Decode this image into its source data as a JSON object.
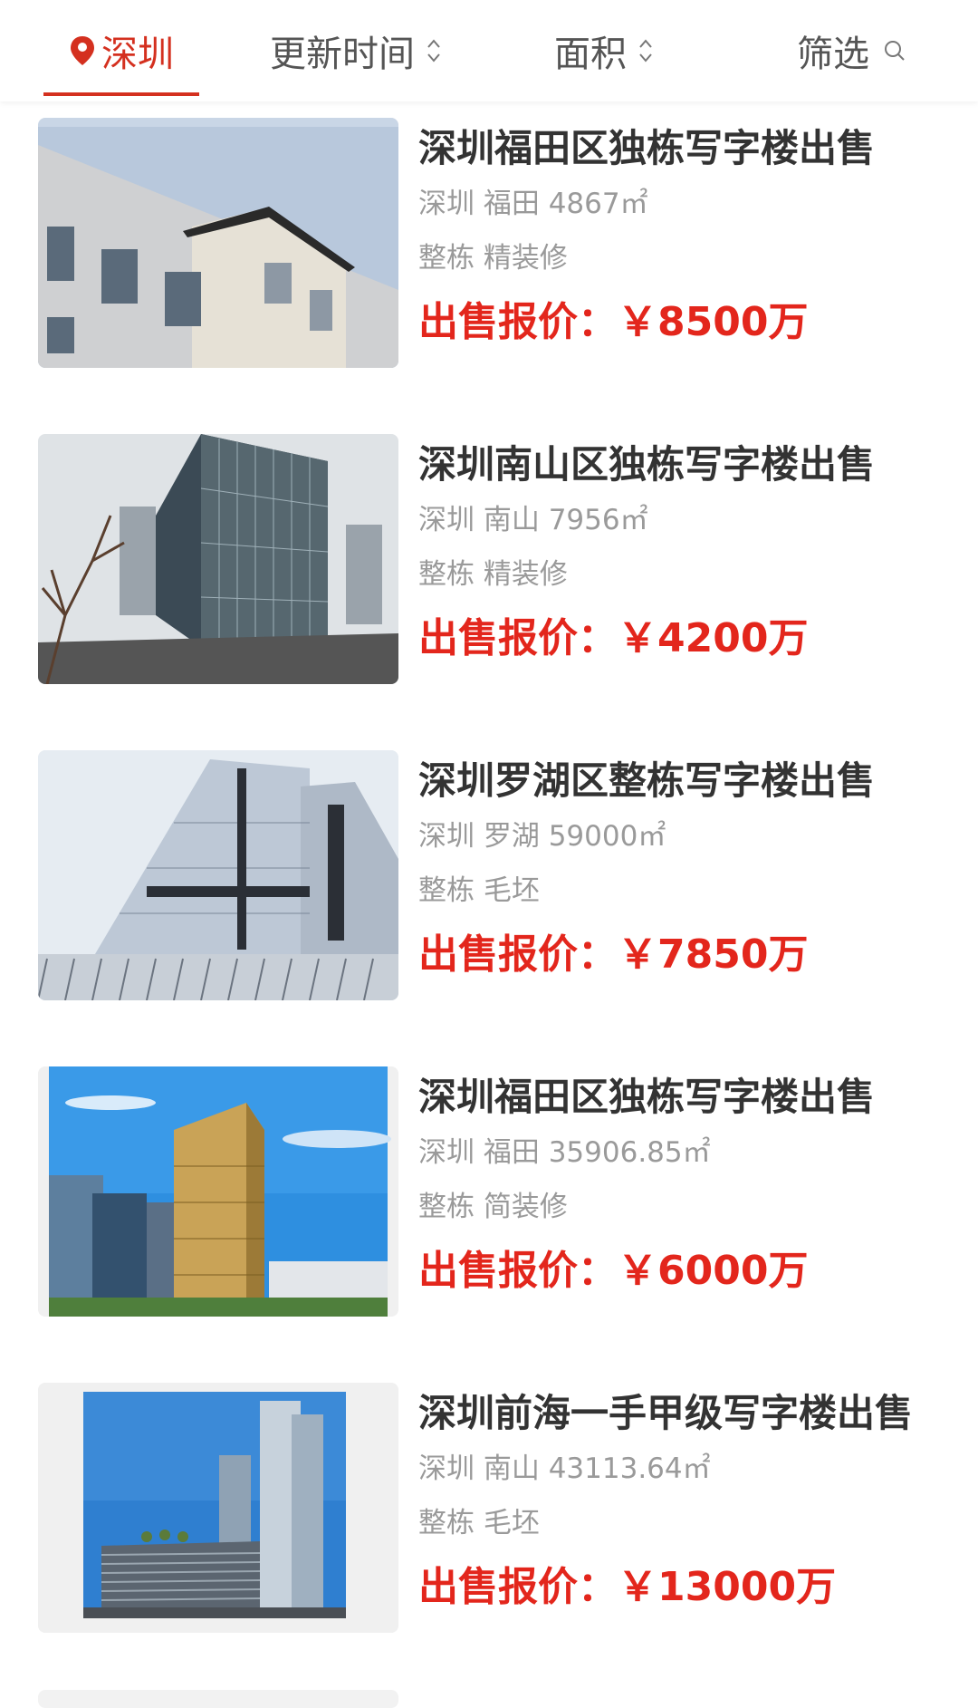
{
  "filter_bar": {
    "city": "深圳",
    "sort_time": "更新时间",
    "sort_area": "面积",
    "filter": "筛选",
    "accent_color": "#d4301f"
  },
  "listings": [
    {
      "title": "深圳福田区独栋写字楼出售",
      "location": "深圳 福田 4867㎡",
      "features": "整栋 精装修",
      "price": "出售报价：￥8500万"
    },
    {
      "title": "深圳南山区独栋写字楼出售",
      "location": "深圳 南山 7956㎡",
      "features": "整栋 精装修",
      "price": "出售报价：￥4200万"
    },
    {
      "title": "深圳罗湖区整栋写字楼出售",
      "location": "深圳 罗湖 59000㎡",
      "features": "整栋 毛坯",
      "price": "出售报价：￥7850万"
    },
    {
      "title": "深圳福田区独栋写字楼出售",
      "location": "深圳 福田 35906.85㎡",
      "features": "整栋 简装修",
      "price": "出售报价：￥6000万"
    },
    {
      "title": "深圳前海一手甲级写字楼出售",
      "location": "深圳 南山 43113.64㎡",
      "features": "整栋 毛坯",
      "price": "出售报价：￥13000万"
    }
  ],
  "icons": {
    "location": "location-pin-icon",
    "sort": "sort-updown-icon",
    "search": "search-icon"
  },
  "colors": {
    "price": "#e3261c",
    "meta": "#9a9a9a"
  }
}
